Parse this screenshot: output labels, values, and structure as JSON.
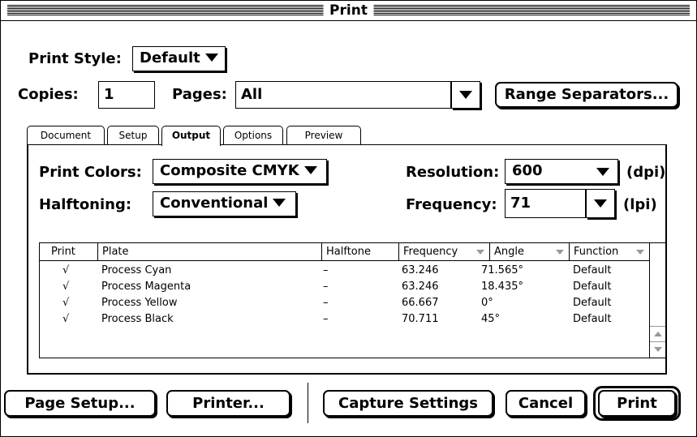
{
  "window": {
    "title": "Print"
  },
  "print_style": {
    "label": "Print Style:",
    "value": "Default"
  },
  "copies": {
    "label": "Copies:",
    "value": "1"
  },
  "pages": {
    "label": "Pages:",
    "value": "All"
  },
  "range_separators_label": "Range Separators...",
  "tabs": [
    {
      "label": "Document",
      "active": false
    },
    {
      "label": "Setup",
      "active": false
    },
    {
      "label": "Output",
      "active": true
    },
    {
      "label": "Options",
      "active": false
    },
    {
      "label": "Preview",
      "active": false
    }
  ],
  "output": {
    "print_colors": {
      "label": "Print Colors:",
      "value": "Composite CMYK"
    },
    "halftoning": {
      "label": "Halftoning:",
      "value": "Conventional"
    },
    "resolution": {
      "label": "Resolution:",
      "value": "600",
      "unit": "(dpi)"
    },
    "frequency": {
      "label": "Frequency:",
      "value": "71",
      "unit": "(lpi)"
    }
  },
  "table": {
    "columns": [
      "Print",
      "Plate",
      "Halftone",
      "Frequency",
      "Angle",
      "Function"
    ],
    "rows": [
      {
        "print": "√",
        "plate": "Process Cyan",
        "halftone": "–",
        "frequency": "63.246",
        "angle": "71.565°",
        "function": "Default"
      },
      {
        "print": "√",
        "plate": "Process Magenta",
        "halftone": "–",
        "frequency": "63.246",
        "angle": "18.435°",
        "function": "Default"
      },
      {
        "print": "√",
        "plate": "Process Yellow",
        "halftone": "–",
        "frequency": "66.667",
        "angle": "0°",
        "function": "Default"
      },
      {
        "print": "√",
        "plate": "Process Black",
        "halftone": "–",
        "frequency": "70.711",
        "angle": "45°",
        "function": "Default"
      }
    ]
  },
  "buttons": {
    "page_setup": "Page Setup...",
    "printer": "Printer...",
    "capture_settings": "Capture Settings",
    "cancel": "Cancel",
    "print": "Print"
  }
}
